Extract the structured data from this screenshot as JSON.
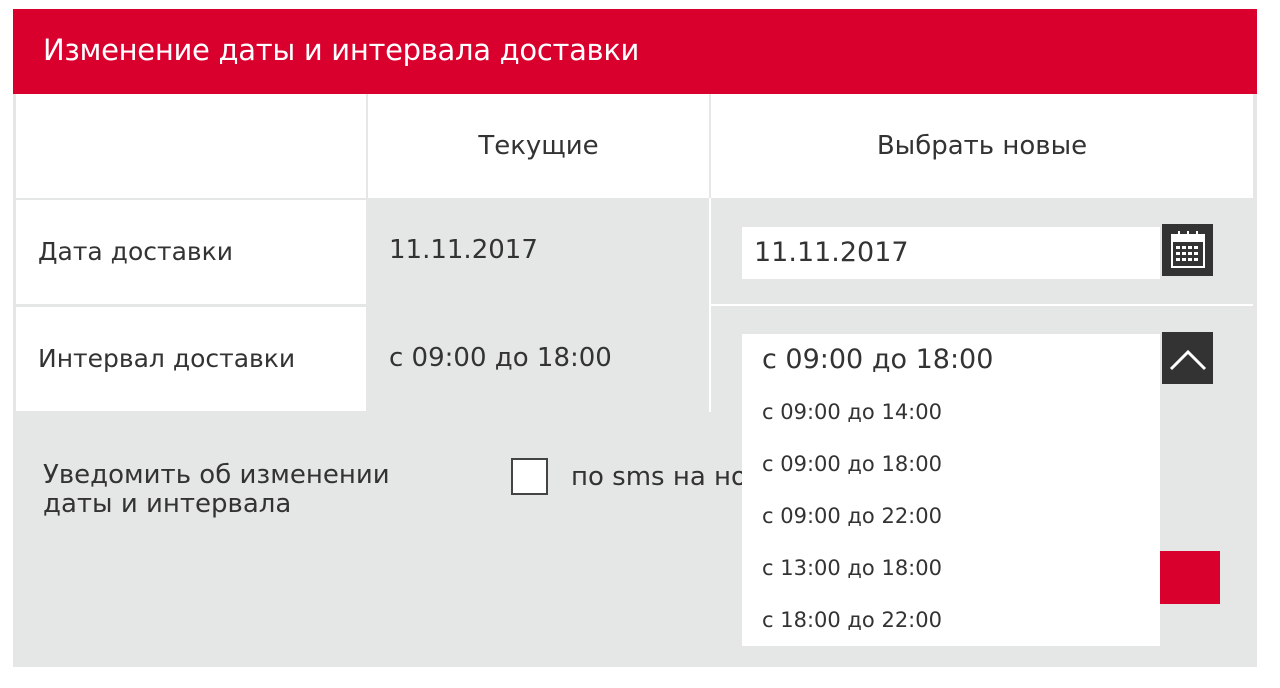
{
  "header": {
    "title": "Изменение даты и интервала доставки"
  },
  "table": {
    "col_current": "Текущие",
    "col_new": "Выбрать новые",
    "rows": [
      {
        "label": "Дата доставки",
        "current": "11.11.2017",
        "new_value": "11.11.2017"
      },
      {
        "label": "Интервал доставки",
        "current": "с 09:00 до 18:00",
        "new_value": "с 09:00 до 18:00"
      }
    ]
  },
  "notify": {
    "label": "Уведомить об изменении даты и интервала",
    "sms_label": "по sms на но",
    "checked": false
  },
  "interval_dropdown": {
    "options": [
      "с 09:00 до 14:00",
      "с 09:00 до 18:00",
      "с 09:00 до 22:00",
      "с 13:00 до 18:00",
      "с 18:00 до 22:00"
    ]
  },
  "icons": {
    "calendar": "calendar-icon",
    "chevron": "chevron-up-icon"
  },
  "colors": {
    "accent": "#d9002e",
    "panel": "#e5e7e6",
    "dark_button": "#333333"
  }
}
